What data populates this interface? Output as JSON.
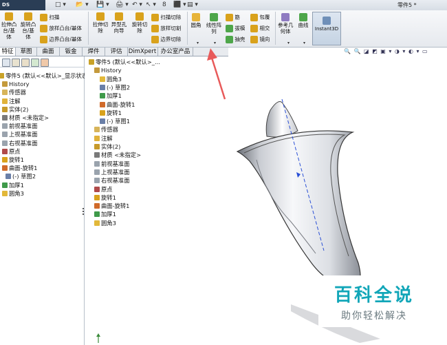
{
  "app": {
    "logo_text": "DS SOLIDWORKS",
    "document_title": "零件5 *"
  },
  "quick_access": [
    "□ ▾",
    "📂 ▾",
    "💾 ▾",
    "🖨 ▾",
    "↶ ▾",
    "↖ ▾",
    "8",
    "⬛ ▾",
    "▤ ▾"
  ],
  "ribbon": {
    "big_buttons": [
      {
        "label": "拉伸凸\n台/基\n体",
        "color": "#d9a21c"
      },
      {
        "label": "旋转凸\n台/基\n体",
        "color": "#d9a21c"
      },
      {
        "label": "拉伸切\n除",
        "color": "#d9a21c"
      },
      {
        "label": "异型孔\n向导",
        "color": "#d9a21c"
      },
      {
        "label": "旋转切\n除",
        "color": "#d9a21c"
      },
      {
        "label": "圆角",
        "color": "#e7b43a"
      },
      {
        "label": "线性阵\n列",
        "color": "#4ea64a"
      },
      {
        "label": "参考几\n何体",
        "color": "#8f7bc2"
      },
      {
        "label": "曲线",
        "color": "#4ea64a"
      }
    ],
    "small_buttons": {
      "col1": [
        "扫描",
        "放样凸台/基体",
        "边界凸台/基体"
      ],
      "col2": [
        "扫描切除",
        "放样切割",
        "边界切除"
      ],
      "col3": [
        "筋",
        "拔模",
        "抽壳"
      ],
      "col4": [
        "包覆",
        "相交",
        "镜向"
      ]
    },
    "instant3d_label": "Instant3D"
  },
  "tabs": [
    {
      "label": "特征",
      "active": true
    },
    {
      "label": "草图",
      "active": false
    },
    {
      "label": "曲面",
      "active": false
    },
    {
      "label": "钣金",
      "active": false
    },
    {
      "label": "焊件",
      "active": false
    },
    {
      "label": "评估",
      "active": false
    },
    {
      "label": "DimXpert",
      "active": false
    },
    {
      "label": "办公室产品",
      "active": false
    }
  ],
  "view_toolbar_glyphs": "🔍 🔍 ◪ ◩ ▣ ▾ ◑ ▾ ◐ ▾ ▭",
  "feature_tree": [
    {
      "label": "零件5 (默认<<默认>_显示状态",
      "icon": "part",
      "indent": 0
    },
    {
      "label": "History",
      "icon": "history",
      "indent": 1
    },
    {
      "label": "传感器",
      "icon": "sensor",
      "indent": 1
    },
    {
      "label": "注解",
      "icon": "annotation",
      "indent": 1
    },
    {
      "label": "实体(2)",
      "icon": "solid",
      "indent": 1
    },
    {
      "label": "材质 <未指定>",
      "icon": "material",
      "indent": 1
    },
    {
      "label": "前视基准面",
      "icon": "plane",
      "indent": 1
    },
    {
      "label": "上视基准面",
      "icon": "plane",
      "indent": 1
    },
    {
      "label": "右视基准面",
      "icon": "plane",
      "indent": 1
    },
    {
      "label": "原点",
      "icon": "origin",
      "indent": 1
    },
    {
      "label": "旋转1",
      "icon": "revolve",
      "indent": 1
    },
    {
      "label": "曲面-旋转1",
      "icon": "surface",
      "indent": 1
    },
    {
      "label": "(-) 草图2",
      "icon": "sketch",
      "indent": 2
    },
    {
      "label": "加厚1",
      "icon": "thicken",
      "indent": 1
    },
    {
      "label": "圆角3",
      "icon": "fillet",
      "indent": 1
    }
  ],
  "flyout_tree": [
    {
      "label": "零件5 (默认<<默认>_...",
      "icon": "part",
      "indent": 0
    },
    {
      "label": "History",
      "icon": "history",
      "indent": 1
    },
    {
      "label": "圆角3",
      "icon": "fillet",
      "indent": 2
    },
    {
      "label": "(-) 草图2",
      "icon": "sketch",
      "indent": 2
    },
    {
      "label": "加厚1",
      "icon": "thicken",
      "indent": 2
    },
    {
      "label": "曲面-旋转1",
      "icon": "surface",
      "indent": 2
    },
    {
      "label": "旋转1",
      "icon": "revolve",
      "indent": 2
    },
    {
      "label": "(-) 草图1",
      "icon": "sketch",
      "indent": 2
    },
    {
      "label": "传感器",
      "icon": "sensor",
      "indent": 1
    },
    {
      "label": "注解",
      "icon": "annotation",
      "indent": 1
    },
    {
      "label": "实体(2)",
      "icon": "solid",
      "indent": 1
    },
    {
      "label": "材质 <未指定>",
      "icon": "material",
      "indent": 1
    },
    {
      "label": "前视基准面",
      "icon": "plane",
      "indent": 1
    },
    {
      "label": "上视基准面",
      "icon": "plane",
      "indent": 1
    },
    {
      "label": "右视基准面",
      "icon": "plane",
      "indent": 1
    },
    {
      "label": "原点",
      "icon": "origin",
      "indent": 1
    },
    {
      "label": "旋转1",
      "icon": "revolve",
      "indent": 1
    },
    {
      "label": "曲面-旋转1",
      "icon": "surface",
      "indent": 1
    },
    {
      "label": "加厚1",
      "icon": "thicken",
      "indent": 1
    },
    {
      "label": "圆角3",
      "icon": "fillet",
      "indent": 1
    }
  ],
  "icon_colors": {
    "part": "#c9a227",
    "history": "#c49a3c",
    "sensor": "#d7b45a",
    "annotation": "#e0b23a",
    "solid": "#c79a2a",
    "material": "#7a7a7a",
    "plane": "#9aa3ad",
    "origin": "#b04a4a",
    "revolve": "#d9a21c",
    "surface": "#d06a2a",
    "sketch": "#6a7fa8",
    "thicken": "#3f9a4a",
    "fillet": "#e2b83a"
  },
  "watermark": {
    "title": "百科全说",
    "subtitle": "助你轻松解决"
  },
  "accent_color": "#e85a5a"
}
